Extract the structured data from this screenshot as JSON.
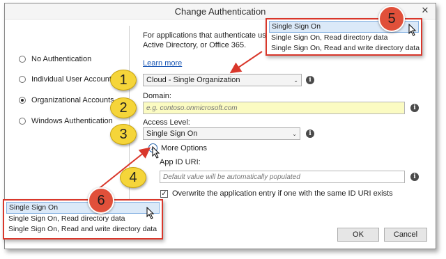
{
  "window": {
    "title": "Change Authentication",
    "close_glyph": "✕"
  },
  "description": {
    "line1": "For applications that authenticate us",
    "line2": "Active Directory, or Office 365."
  },
  "learn_more": "Learn more",
  "auth_options": [
    {
      "label": "No Authentication",
      "checked": false
    },
    {
      "label": "Individual User Accounts",
      "checked": false
    },
    {
      "label": "Organizational Accounts",
      "checked": true
    },
    {
      "label": "Windows Authentication",
      "checked": false
    }
  ],
  "tenant_type": {
    "value": "Cloud - Single Organization"
  },
  "domain": {
    "label": "Domain:",
    "placeholder": "e.g. contoso.onmicrosoft.com"
  },
  "access_level": {
    "label": "Access Level:",
    "value": "Single Sign On"
  },
  "more_options": {
    "label": "More Options",
    "expander_glyph": "▲"
  },
  "app_id": {
    "label": "App ID URI:",
    "placeholder": "Default value will be automatically populated"
  },
  "overwrite": {
    "label": "Overwrite the application entry if one with the same ID URI exists",
    "checked": true
  },
  "buttons": {
    "ok": "OK",
    "cancel": "Cancel"
  },
  "callouts": {
    "c1": "1",
    "c2": "2",
    "c3": "3",
    "c4": "4",
    "c5": "5",
    "c6": "6"
  },
  "dropdown_top": [
    "Single Sign On",
    "Single Sign On, Read directory data",
    "Single Sign On, Read and write directory data"
  ],
  "dropdown_bottom": [
    "Single Sign On",
    "Single Sign On, Read directory data",
    "Single Sign On, Read and write directory data"
  ],
  "icons": {
    "info": "i",
    "chevron": "⌄",
    "check": "✓"
  },
  "colors": {
    "highlight_red": "#d9372b",
    "callout_yellow": "#f5d53a",
    "domain_field_bg": "#fbfbc2",
    "link_blue": "#1a57b5"
  }
}
